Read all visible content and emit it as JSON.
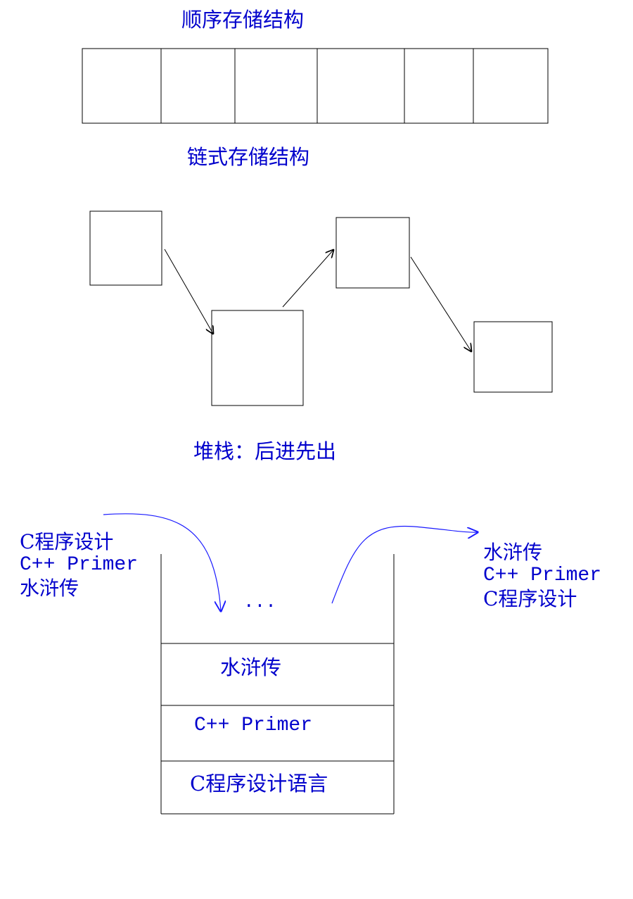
{
  "sections": {
    "sequential_title": "顺序存储结构",
    "linked_title": "链式存储结构",
    "stack_title": "堆栈：后进先出"
  },
  "push_list": [
    "C程序设计",
    "C++ Primer",
    "水浒传"
  ],
  "pop_list": [
    "水浒传",
    "C++ Primer",
    "C程序设计"
  ],
  "stack": {
    "top_placeholder": "...",
    "items": [
      "水浒传",
      "C++ Primer",
      "C程序设计语言"
    ]
  },
  "colors": {
    "text": "#0000cc",
    "arrow_blue": "#1a1aff",
    "line": "#000000"
  }
}
